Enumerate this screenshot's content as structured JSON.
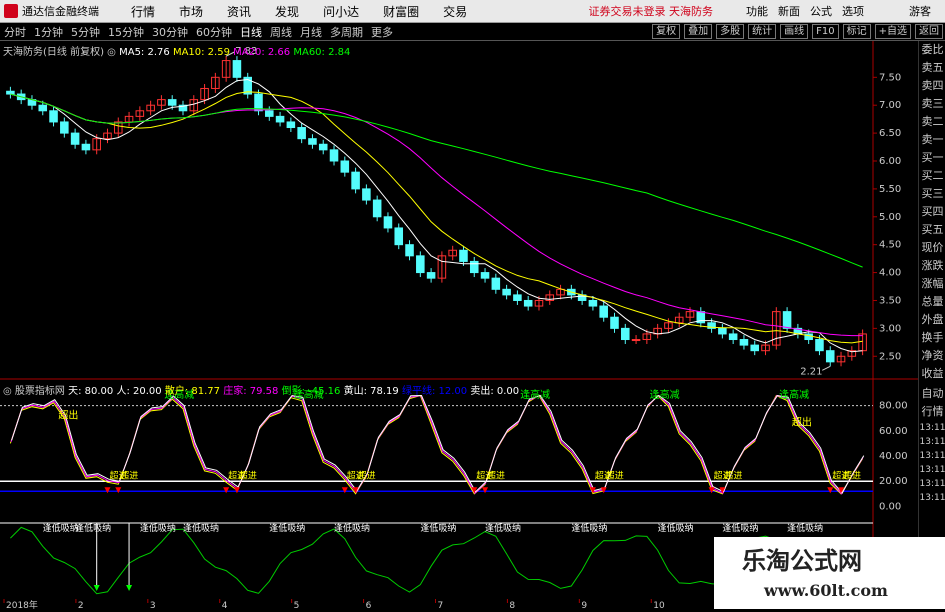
{
  "app": {
    "title": "通达信金融终端",
    "status": "证券交易未登录 天海防务",
    "guest": "游客"
  },
  "menu": [
    "行情",
    "市场",
    "资讯",
    "发现",
    "问小达",
    "财富圈",
    "交易"
  ],
  "right_menu": [
    "功能",
    "新面",
    "公式",
    "选项"
  ],
  "periods": [
    "分时",
    "1分钟",
    "5分钟",
    "15分钟",
    "30分钟",
    "60分钟",
    "日线",
    "周线",
    "月线",
    "多周期",
    "更多"
  ],
  "active_period": "日线",
  "toolbar_right": [
    "复权",
    "叠加",
    "多股",
    "统计",
    "画线",
    "F10",
    "标记",
    "+自选",
    "返回"
  ],
  "main_legend": {
    "title": "天海防务(日线 前复权)",
    "ma5": "MA5: 2.76",
    "ma10": "MA10: 2.59",
    "ma20": "MA20: 2.66",
    "ma60": "MA60: 2.84"
  },
  "price_labels": [
    "7.50",
    "7.00",
    "6.50",
    "6.00",
    "5.50",
    "5.00",
    "4.50",
    "4.00",
    "3.50",
    "3.00",
    "2.50"
  ],
  "high_mark": "7.83",
  "low_mark": "2.21",
  "ind_legend": {
    "name": "股票指标网",
    "tian": "天: 80.00",
    "ren": "人: 20.00",
    "sanhu": "散户: 81.77",
    "zhuangjia": "庄家: 79.58",
    "daoying": "倒影: -45.16",
    "huangshan": "黄山: 78.19",
    "lvping": "绿平线: 12.00",
    "maichu": "卖出: 0.00"
  },
  "ind_labels": [
    "80.00",
    "60.00",
    "40.00",
    "20.00",
    "0.00"
  ],
  "signals": {
    "reduce": "逢高减",
    "out": "超出",
    "in": "超进",
    "buy": "逢低买入",
    "low": "逢低吸纳"
  },
  "sidebar": [
    "委比",
    "卖五",
    "卖四",
    "卖三",
    "卖二",
    "卖一",
    "买一",
    "买二",
    "买三",
    "买四",
    "买五",
    "现价",
    "涨跌",
    "涨幅",
    "总量",
    "外盘",
    "换手",
    "净资",
    "收益"
  ],
  "sidebar_lower": [
    "自动",
    "行情",
    "13:11",
    "13:11",
    "13:11",
    "13:11",
    "13:11",
    "13:11",
    "13:11",
    "13:11",
    "13:11"
  ],
  "xaxis": [
    "2018年",
    "2",
    "3",
    "4",
    "5",
    "6",
    "7",
    "8",
    "9",
    "10",
    "11",
    "12"
  ],
  "watermark": {
    "cn": "乐淘公式网",
    "url": "www.60lt.com"
  },
  "colors": {
    "up": "#ff3232",
    "down": "#54fcfc",
    "ma5": "#ffffff",
    "ma10": "#ffff00",
    "ma20": "#ff00ff",
    "ma60": "#00ff00"
  },
  "chart_data": {
    "type": "candlestick",
    "title": "天海防务(日线 前复权)",
    "ylim": [
      2.2,
      7.9
    ],
    "close": [
      7.2,
      7.1,
      7.0,
      6.9,
      6.7,
      6.5,
      6.3,
      6.2,
      6.4,
      6.5,
      6.7,
      6.8,
      6.9,
      7.0,
      7.1,
      7.0,
      6.9,
      7.1,
      7.3,
      7.5,
      7.8,
      7.5,
      7.2,
      6.9,
      6.8,
      6.7,
      6.6,
      6.4,
      6.3,
      6.2,
      6.0,
      5.8,
      5.5,
      5.3,
      5.0,
      4.8,
      4.5,
      4.3,
      4.0,
      3.9,
      4.3,
      4.4,
      4.2,
      4.0,
      3.9,
      3.7,
      3.6,
      3.5,
      3.4,
      3.5,
      3.6,
      3.7,
      3.6,
      3.5,
      3.4,
      3.2,
      3.0,
      2.8,
      2.8,
      2.9,
      3.0,
      3.1,
      3.2,
      3.3,
      3.1,
      3.0,
      2.9,
      2.8,
      2.7,
      2.6,
      2.7,
      3.3,
      3.0,
      2.9,
      2.8,
      2.6,
      2.4,
      2.5,
      2.6,
      2.9
    ]
  }
}
